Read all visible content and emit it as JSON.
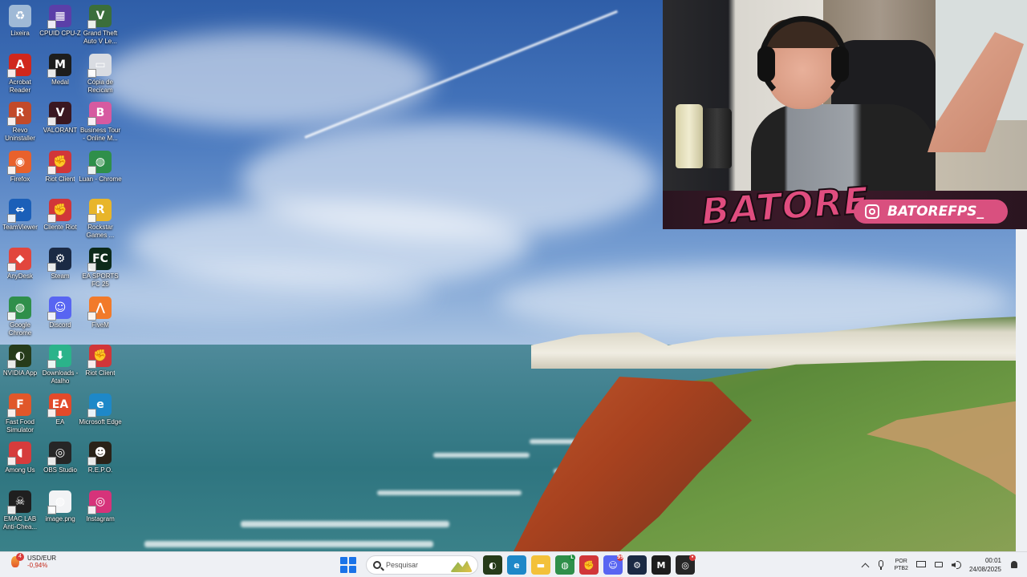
{
  "desktop": {
    "icons": [
      {
        "label": "Lixeira",
        "icon": "recycle-bin-icon",
        "color": "#9fb9d6",
        "glyph": "♻"
      },
      {
        "label": "CPUID CPU-Z",
        "icon": "cpuz-icon",
        "color": "#5b3fa8",
        "glyph": "▦"
      },
      {
        "label": "Grand Theft Auto V Le...",
        "icon": "gta-icon",
        "color": "#3b6e3b",
        "glyph": "V"
      },
      {
        "label": "Acrobat Reader",
        "icon": "acrobat-icon",
        "color": "#d0271d",
        "glyph": "A"
      },
      {
        "label": "Medal",
        "icon": "medal-icon",
        "color": "#1d1d1d",
        "glyph": "M"
      },
      {
        "label": "Cópia de Recicam",
        "icon": "file-copy-icon",
        "color": "#d9dce2",
        "glyph": "▭"
      },
      {
        "label": "Revo Uninstaller",
        "icon": "revo-icon",
        "color": "#c24a2a",
        "glyph": "R"
      },
      {
        "label": "VALORANT",
        "icon": "valorant-icon",
        "color": "#3a1720",
        "glyph": "V"
      },
      {
        "label": "Business Tour - Online M...",
        "icon": "business-tour-icon",
        "color": "#d65aa0",
        "glyph": "B"
      },
      {
        "label": "Firefox",
        "icon": "firefox-icon",
        "color": "#e8612c",
        "glyph": "◉"
      },
      {
        "label": "Riot Client",
        "icon": "riot-icon",
        "color": "#d13639",
        "glyph": "✊"
      },
      {
        "label": "Luan - Chrome",
        "icon": "chrome-profile-icon",
        "color": "#2f8f4a",
        "glyph": "◍"
      },
      {
        "label": "TeamViewer",
        "icon": "teamviewer-icon",
        "color": "#1b5fb8",
        "glyph": "⇔"
      },
      {
        "label": "Cliente Riot",
        "icon": "riot-icon",
        "color": "#d13639",
        "glyph": "✊"
      },
      {
        "label": "Rockstar Games ...",
        "icon": "rockstar-icon",
        "color": "#e8b52a",
        "glyph": "R"
      },
      {
        "label": "AnyDesk",
        "icon": "anydesk-icon",
        "color": "#e2463d",
        "glyph": "◆"
      },
      {
        "label": "Steam",
        "icon": "steam-icon",
        "color": "#1b2a44",
        "glyph": "⚙"
      },
      {
        "label": "EA SPORTS FC 25",
        "icon": "easports-icon",
        "color": "#0d2a1a",
        "glyph": "FC"
      },
      {
        "label": "Google Chrome",
        "icon": "chrome-icon",
        "color": "#2f8f4a",
        "glyph": "◍"
      },
      {
        "label": "Discord",
        "icon": "discord-icon",
        "color": "#5865f2",
        "glyph": "☺"
      },
      {
        "label": "FiveM",
        "icon": "fivem-icon",
        "color": "#f27a2a",
        "glyph": "⋀"
      },
      {
        "label": "NVIDIA App",
        "icon": "nvidia-icon",
        "color": "#263b1a",
        "glyph": "◐"
      },
      {
        "label": "Downloads - Atalho",
        "icon": "downloads-icon",
        "color": "#2bb38a",
        "glyph": "⬇"
      },
      {
        "label": "Riot Client",
        "icon": "riot-icon",
        "color": "#d13639",
        "glyph": "✊"
      },
      {
        "label": "Fast Food Simulator",
        "icon": "fastfood-icon",
        "color": "#e0572a",
        "glyph": "F"
      },
      {
        "label": "EA",
        "icon": "ea-icon",
        "color": "#e24a2a",
        "glyph": "EA"
      },
      {
        "label": "Microsoft Edge",
        "icon": "edge-icon",
        "color": "#1e88c8",
        "glyph": "e"
      },
      {
        "label": "Among Us",
        "icon": "amongus-icon",
        "color": "#d63c3c",
        "glyph": "◖"
      },
      {
        "label": "OBS Studio",
        "icon": "obs-icon",
        "color": "#262626",
        "glyph": "◎"
      },
      {
        "label": "R.E.P.O.",
        "icon": "repo-icon",
        "color": "#2a2218",
        "glyph": "☻"
      },
      {
        "label": "EMAC LAB Anti-Chea...",
        "icon": "emac-icon",
        "color": "#1f1f1f",
        "glyph": "☠"
      },
      {
        "label": "image.png",
        "icon": "image-file-icon",
        "color": "#f2f3f5",
        "glyph": "◍"
      },
      {
        "label": "Instagram",
        "icon": "instagram-icon",
        "color": "#d6337a",
        "glyph": "◎"
      }
    ]
  },
  "webcam": {
    "brand_text": "BATORE",
    "instagram_handle": "BATOREFPS_"
  },
  "taskbar": {
    "widget": {
      "badge": "4",
      "pair": "USD/EUR",
      "change": "-0,94%"
    },
    "search_placeholder": "Pesquisar",
    "apps": [
      {
        "icon": "nvidia-taskbar-icon",
        "color": "#263b1a",
        "glyph": "◐",
        "badge": ""
      },
      {
        "icon": "edge-taskbar-icon",
        "color": "#1e88c8",
        "glyph": "e",
        "badge": ""
      },
      {
        "icon": "file-explorer-icon",
        "color": "#f3c13a",
        "glyph": "▬",
        "badge": ""
      },
      {
        "icon": "chrome-taskbar-icon",
        "color": "#2f8f4a",
        "glyph": "◍",
        "badge": "L"
      },
      {
        "icon": "riot-taskbar-icon",
        "color": "#d13639",
        "glyph": "✊",
        "badge": ""
      },
      {
        "icon": "discord-taskbar-icon",
        "color": "#5865f2",
        "glyph": "☺",
        "badge": "99"
      },
      {
        "icon": "steam-taskbar-icon",
        "color": "#1b2a44",
        "glyph": "⚙",
        "badge": ""
      },
      {
        "icon": "medal-taskbar-icon",
        "color": "#1d1d1d",
        "glyph": "M",
        "badge": ""
      },
      {
        "icon": "obs-taskbar-icon",
        "color": "#262626",
        "glyph": "◎",
        "badge": "•"
      }
    ],
    "tray": {
      "lang_top": "POR",
      "lang_bottom": "PTB2",
      "time": "00:01",
      "date": "24/08/2025"
    }
  }
}
